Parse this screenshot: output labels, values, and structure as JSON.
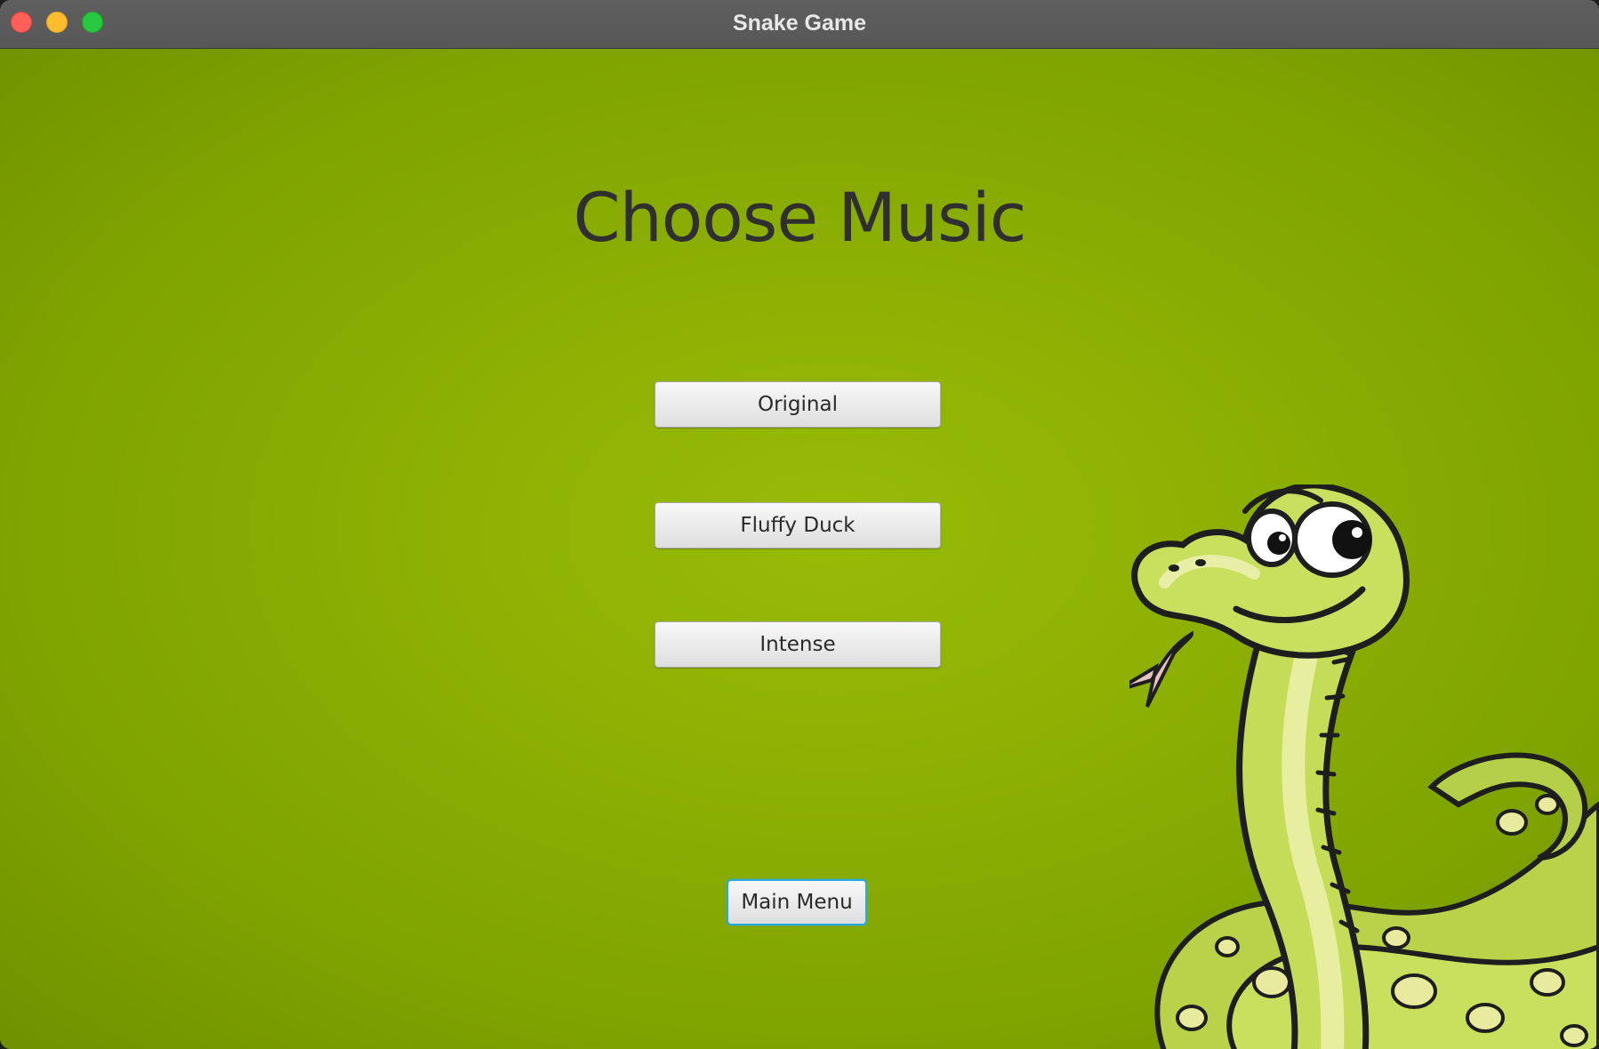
{
  "window": {
    "title": "Snake Game"
  },
  "screen": {
    "heading": "Choose Music"
  },
  "music_options": [
    {
      "label": "Original"
    },
    {
      "label": "Fluffy Duck"
    },
    {
      "label": "Intense"
    }
  ],
  "navigation": {
    "main_menu_label": "Main Menu"
  },
  "colors": {
    "background_green": "#8db004",
    "focus_ring": "#2aa9e0",
    "snake_body": "#c7dd5a",
    "snake_spots": "#e6eb9a"
  },
  "decoration": {
    "mascot_icon": "cartoon-snake-icon"
  }
}
